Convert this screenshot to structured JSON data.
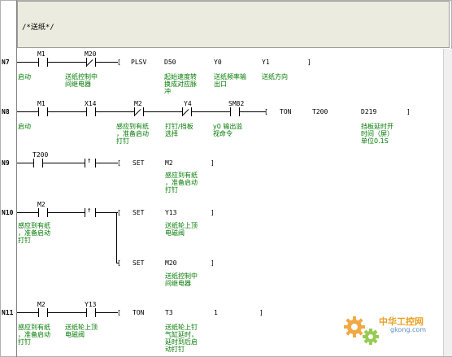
{
  "header": {
    "comment": "/*送纸*/"
  },
  "networks": [
    {
      "number": "N7",
      "operands": {
        "c1": "M1",
        "c2": "M20",
        "instr": "PLSV",
        "p1": "D50",
        "p2": "Y0",
        "p3": "Y1"
      },
      "comments": {
        "c1": "启动",
        "c2": "送纸控制中\n间继电器",
        "p1": "起始速度转\n换成对应脉\n冲",
        "p2": "送纸频率输\n出口",
        "p3": "送纸方向"
      }
    },
    {
      "number": "N8",
      "operands": {
        "c1": "M1",
        "c2": "X14",
        "c3": "M2",
        "c4": "Y4",
        "c5": "SM82",
        "instr": "TON",
        "p1": "T200",
        "p2": "D219"
      },
      "comments": {
        "c1": "启动",
        "c3": "感应到有纸\n，准备启动\n打钉",
        "c4": "打钉/挡板\n选择",
        "c5": "y0 输出监\n视命令",
        "p2": "挡板延时开\n时间（屏）\n单位0.1S"
      }
    },
    {
      "number": "N9",
      "operands": {
        "c1": "T200",
        "instr": "SET",
        "p1": "M2"
      },
      "comments": {
        "p1": "感应到有纸\n，准备启动\n打钉"
      }
    },
    {
      "number": "N10",
      "operands": {
        "c1": "M2",
        "instr": "SET",
        "p1": "Y13",
        "instr2": "SET",
        "p2": "M20"
      },
      "comments": {
        "c1": "感应到有纸\n，准备启动\n打钉",
        "p1": "送纸轮上顶\n电磁阀",
        "p2": "送纸控制中\n间继电器"
      }
    },
    {
      "number": "N11",
      "operands": {
        "c1": "M2",
        "c2": "Y13",
        "instr": "TON",
        "p1": "T3",
        "p2": "1"
      },
      "comments": {
        "c1": "感应到有纸\n，准备启动\n打钉",
        "c2": "送纸轮上顶\n电磁阀",
        "p1": "送纸轮上钉\n气缸延时，\n延时到后启\n动打钉"
      }
    }
  ],
  "watermark": {
    "brand": "中华工控网",
    "url": "gkong.com"
  },
  "colors": {
    "comment_green": "#007a00",
    "header_bg": "#ecebdf",
    "watermark_orange": "#e8a020"
  }
}
